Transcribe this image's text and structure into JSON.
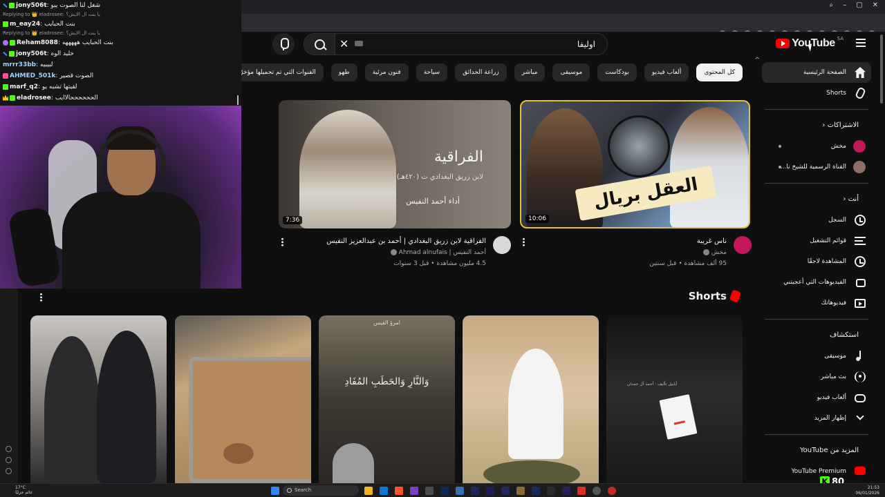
{
  "chat": [
    {
      "user": "jony506t",
      "text": "شغل لنا الصوت يبو",
      "color": "#f1f1f1",
      "badges": [
        "sword",
        "k"
      ]
    },
    {
      "reply": "Replying to 👑 eladrosee: يا بنت ال الايش؟",
      "reply_badges": [
        "k"
      ]
    },
    {
      "user": "m_eay24",
      "text": "بنت الحبايب",
      "color": "#f1f1f1",
      "badges": [
        "k"
      ]
    },
    {
      "reply": "Replying to 👑 eladrosee: يا بنت ال الايش؟",
      "reply_badges": [
        "k"
      ]
    },
    {
      "user": "Reham8088",
      "text": "بنت الحبايب هههههه",
      "color": "#f1f1f1",
      "badges": [
        "star",
        "k"
      ]
    },
    {
      "user": "jony506t",
      "text": "خليد الوه",
      "color": "#f1f1f1",
      "badges": [
        "sword",
        "k"
      ]
    },
    {
      "user": "mrrr33bb",
      "text": "لبيبيه",
      "color": "#9fd3ff",
      "badges": []
    },
    {
      "user": "AHMED_501k",
      "text": "الصوت قصير",
      "color": "#9fd3ff",
      "badges": [
        "gift"
      ]
    },
    {
      "user": "marf_q2",
      "text": "لقيتها تشبه يو",
      "color": "#f1f1f1",
      "badges": [
        "k"
      ]
    },
    {
      "user": "eladrosee",
      "text": "الححححححالاايب",
      "color": "#f1f1f1",
      "badges": [
        "crown",
        "k"
      ]
    }
  ],
  "header": {
    "logo_text": "YouTube",
    "country": "SA",
    "search_value": "اوليفا"
  },
  "chips": [
    {
      "label": "كل المحتوى",
      "active": true
    },
    {
      "label": "ألعاب فيديو"
    },
    {
      "label": "بودكاست"
    },
    {
      "label": "موسيقى"
    },
    {
      "label": "مباشر"
    },
    {
      "label": "زراعة الحدائق"
    },
    {
      "label": "سياحة"
    },
    {
      "label": "فنون مرئية"
    },
    {
      "label": "طهو"
    },
    {
      "label": "القنوات التي تم تحميلها مؤخرًا"
    },
    {
      "label": "تمت مشاهدتها"
    }
  ],
  "sidebar": {
    "main": [
      {
        "label": "الصفحة الرئيسية",
        "icon": "home-icon",
        "active": true
      },
      {
        "label": "Shorts",
        "icon": "shorts-icon"
      }
    ],
    "subscriptions_title": "الاشتراكات",
    "subscriptions": [
      {
        "label": "مخش",
        "avatar_color": "#c2185b"
      },
      {
        "label": "القناة الرسمية للشيخ نا...",
        "avatar_color": "#8d6e63"
      }
    ],
    "you_title": "أنت",
    "you": [
      {
        "label": "السجل",
        "icon": "history-icon"
      },
      {
        "label": "قوائم التشغيل",
        "icon": "playlist-icon"
      },
      {
        "label": "المشاهدة لاحقًا",
        "icon": "watch-later-icon"
      },
      {
        "label": "الفيديوهات التي أعجبتني",
        "icon": "like-icon"
      },
      {
        "label": "فيديوهاتك",
        "icon": "your-videos-icon"
      }
    ],
    "explore_title": "استكشاف",
    "explore": [
      {
        "label": "موسيقى",
        "icon": "music-icon"
      },
      {
        "label": "بث مباشر",
        "icon": "live-icon"
      },
      {
        "label": "ألعاب فيديو",
        "icon": "gaming-icon"
      },
      {
        "label": "إظهار المزيد",
        "icon": "chevron-down-icon"
      }
    ],
    "more_title": "المزيد من YouTube",
    "more": [
      {
        "label": "YouTube Premium"
      }
    ]
  },
  "videos": [
    {
      "title": "ناس غريبة",
      "channel": "مخش",
      "stats": "95 ألف مشاهدة • قبل سنتين",
      "duration": "10:06",
      "thumb_text": "العقل بريال",
      "avatar_color": "#c2185b"
    },
    {
      "title": "الفراقية لابن زريق البغدادي | أحمد بن عبدالعزيز النفيس",
      "channel": "أحمد النفيس | Ahmad alnufais",
      "stats": "4.5 مليون مشاهدة • قبل 3 سنوات",
      "duration": "7:36",
      "thumb_title": "الفراقية",
      "thumb_sub": "لابن زريق البغدادي ت (٤٢٠هـ)",
      "thumb_author": "أداء أحمد النفيس",
      "avatar_color": "#d9d9d9"
    }
  ],
  "shorts": {
    "title": "Shorts",
    "items": [
      {
        "text": ""
      },
      {
        "text": ""
      },
      {
        "text": "وَالنَّارِ وَالحَطَبِ المُفَادِ",
        "top_text": "امرؤ القيس"
      },
      {
        "text": ""
      },
      {
        "text": "أبابيل",
        "top_text": "أبابيل تأليف : أحمد آل حمدان"
      }
    ]
  },
  "taskbar": {
    "weather_temp": "17°C",
    "weather_desc": "غائم جزئيًا",
    "search_label": "Search",
    "time": "21:53",
    "date": "06/01/2026"
  },
  "kick": {
    "badge": "K",
    "count": "80"
  }
}
